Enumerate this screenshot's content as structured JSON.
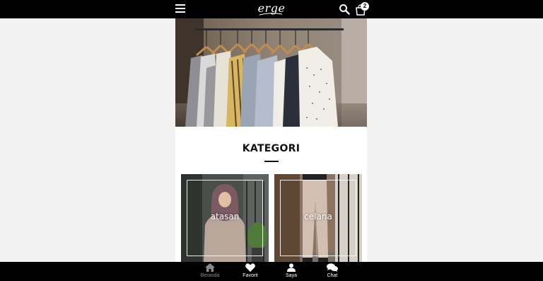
{
  "header": {
    "logo_text": "erge",
    "cart_count": "2",
    "icons": [
      "menu-icon",
      "search-icon",
      "cart-icon"
    ]
  },
  "hero": {
    "image": "clothing-rack-photo"
  },
  "kategori": {
    "title": "KATEGORI",
    "items": [
      {
        "label": "atasan",
        "image": "woman-in-hijab-photo"
      },
      {
        "label": "celana",
        "image": "trousers-photo"
      }
    ]
  },
  "bottom_nav": {
    "items": [
      {
        "label": "Beranda",
        "icon": "home-icon",
        "active": false
      },
      {
        "label": "Favorit",
        "icon": "heart-icon",
        "active": true
      },
      {
        "label": "Saya",
        "icon": "user-icon",
        "active": true
      },
      {
        "label": "Chat",
        "icon": "chat-icon",
        "active": true
      }
    ]
  },
  "colors": {
    "bar": "#000000",
    "page_bg": "#f2f2f2",
    "content_bg": "#ffffff",
    "inactive_nav": "#8a8a8a"
  }
}
